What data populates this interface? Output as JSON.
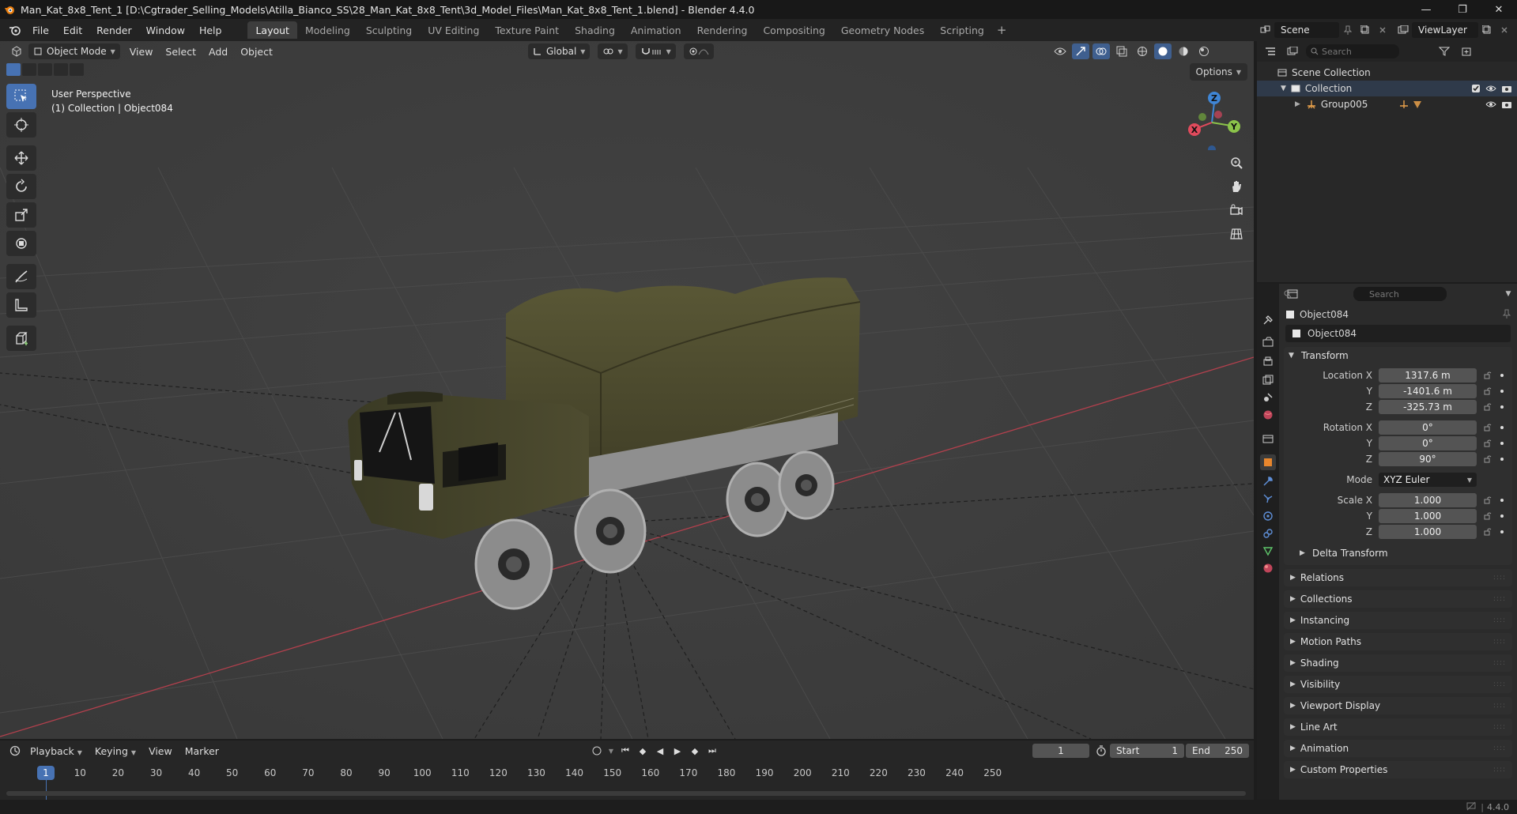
{
  "window": {
    "title": "Man_Kat_8x8_Tent_1 [D:\\Cgtrader_Selling_Models\\Atilla_Bianco_SS\\28_Man_Kat_8x8_Tent\\3d_Model_Files\\Man_Kat_8x8_Tent_1.blend] - Blender 4.4.0",
    "controls": [
      "—",
      "❐",
      "✕"
    ]
  },
  "menu": {
    "items": [
      "File",
      "Edit",
      "Render",
      "Window",
      "Help"
    ],
    "workspaces": [
      "Layout",
      "Modeling",
      "Sculpting",
      "UV Editing",
      "Texture Paint",
      "Shading",
      "Animation",
      "Rendering",
      "Compositing",
      "Geometry Nodes",
      "Scripting"
    ],
    "active_workspace": "Layout",
    "scene": "Scene",
    "view_layer": "ViewLayer"
  },
  "viewport": {
    "mode": "Object Mode",
    "menus": [
      "View",
      "Select",
      "Add",
      "Object"
    ],
    "orientation": "Global",
    "options_label": "Options",
    "perspective": "User Perspective",
    "collection_info": "(1) Collection | Object084",
    "gizmo_axes": [
      "Z",
      "Y",
      "X"
    ]
  },
  "outliner": {
    "search_placeholder": "Search",
    "scene_collection": "Scene Collection",
    "collection": "Collection",
    "group": "Group005"
  },
  "properties": {
    "search_placeholder": "Search",
    "object_name": "Object084",
    "data_name": "Object084",
    "transform": {
      "title": "Transform",
      "location_label": "Location X",
      "location": [
        "1317.6 m",
        "-1401.6 m",
        "-325.73 m"
      ],
      "rotation_label": "Rotation X",
      "rotation": [
        "0°",
        "0°",
        "90°"
      ],
      "mode_label": "Mode",
      "mode": "XYZ Euler",
      "scale_label": "Scale X",
      "scale": [
        "1.000",
        "1.000",
        "1.000"
      ],
      "axis_y": "Y",
      "axis_z": "Z",
      "delta": "Delta Transform"
    },
    "panels": [
      "Relations",
      "Collections",
      "Instancing",
      "Motion Paths",
      "Shading",
      "Visibility",
      "Viewport Display",
      "Line Art",
      "Animation",
      "Custom Properties"
    ]
  },
  "timeline": {
    "menus": [
      "Playback",
      "Keying",
      "View",
      "Marker"
    ],
    "current_frame": "1",
    "start_label": "Start",
    "start": "1",
    "end_label": "End",
    "end": "250",
    "ticks": [
      "10",
      "20",
      "30",
      "40",
      "50",
      "60",
      "70",
      "80",
      "90",
      "100",
      "110",
      "120",
      "130",
      "140",
      "150",
      "160",
      "170",
      "180",
      "190",
      "200",
      "210",
      "220",
      "230",
      "240",
      "250"
    ],
    "playhead_label": "1"
  },
  "status": {
    "version": "4.4.0"
  },
  "colors": {
    "accent": "#4772b3",
    "x_axis": "#e04a5c",
    "y_axis": "#8bc34a",
    "z_axis": "#3f86d6",
    "truck_olive": "#4b4a2e",
    "tarp": "#4c4a30",
    "tyre": "#8a8a8a"
  }
}
